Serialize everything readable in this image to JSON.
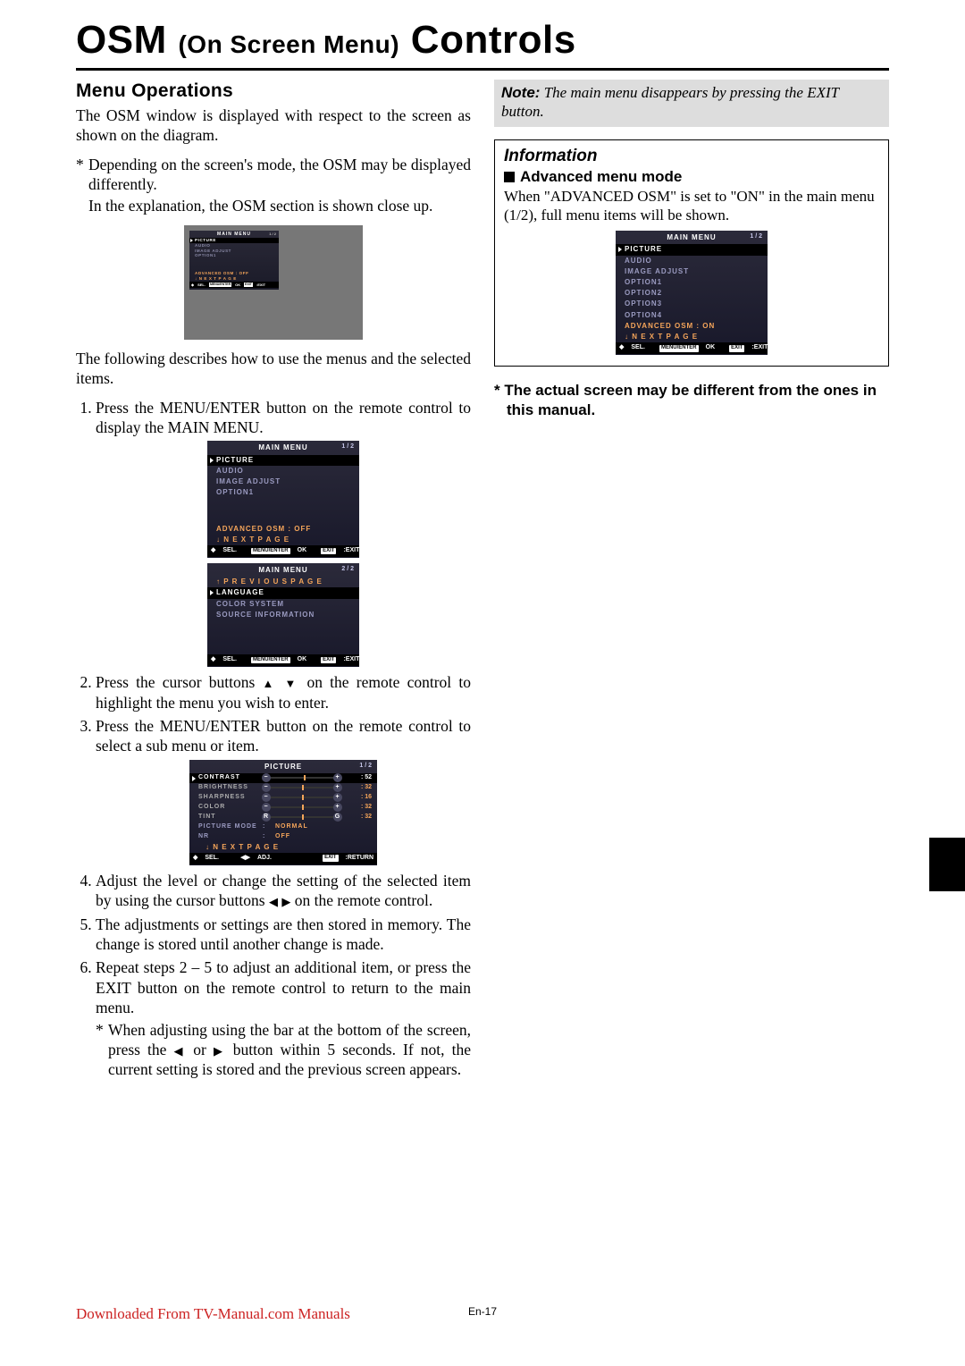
{
  "page": {
    "title_1": "OSM",
    "title_2": "(On Screen Menu)",
    "title_3": "Controls",
    "footer_link": "Downloaded From TV-Manual.com Manuals",
    "footer_page": "En-17"
  },
  "left": {
    "heading": "Menu Operations",
    "p1": "The OSM window is displayed with respect to the screen as shown on the diagram.",
    "star1": "Depending on the screen's mode, the OSM may be displayed differently.",
    "star1b": "In the explanation, the OSM section is shown close up.",
    "p2": "The following describes how to use the menus and the selected items.",
    "s1": "Press the MENU/ENTER button on the remote control to display the MAIN MENU.",
    "s2a": "Press the cursor buttons ",
    "s2b": " on the remote control to highlight the menu you wish to enter.",
    "s3": "Press the MENU/ENTER button on the remote control to select a sub menu or item.",
    "s4a": "Adjust the level or change the setting of the selected item by using the cursor buttons ",
    "s4b": " on the remote control.",
    "s5": "The adjustments or settings are then stored in memory. The change is stored until another change is made.",
    "s6": "Repeat steps 2 – 5 to adjust an additional item, or press the EXIT button on the remote control to return to the main menu.",
    "s6_star_a": "When adjusting using the bar at the bottom of the screen, press the ",
    "s6_star_b": " or ",
    "s6_star_c": " button within 5 seconds. If not, the current setting is stored and the previous screen appears."
  },
  "osd_common": {
    "main_title": "MAIN MENU",
    "picture_title": "PICTURE",
    "page12": "1 / 2",
    "page22": "2 / 2",
    "sel": "SEL.",
    "adj": "ADJ.",
    "menu_enter": "MENU/ENTER",
    "ok": "OK",
    "exit_btn": "EXIT",
    "exit_txt": ":EXIT",
    "return_txt": ":RETURN",
    "items_basic": [
      "PICTURE",
      "AUDIO",
      "IMAGE ADJUST",
      "OPTION1"
    ],
    "adv_off": "ADVANCED OSM   :   OFF",
    "adv_on": "ADVANCED OSM   :   ON",
    "next": "↓  N E X T   P A G E",
    "prev": "↑  P R E V I O U S   P A G E",
    "items_p2": [
      "LANGUAGE",
      "COLOR SYSTEM",
      "SOURCE INFORMATION"
    ],
    "items_full": [
      "PICTURE",
      "AUDIO",
      "IMAGE ADJUST",
      "OPTION1",
      "OPTION2",
      "OPTION3",
      "OPTION4"
    ]
  },
  "picture_adj": {
    "rows": [
      {
        "label": "CONTRAST",
        "val": 52,
        "pos": 52,
        "l": "−",
        "r": "+"
      },
      {
        "label": "BRIGHTNESS",
        "val": 32,
        "pos": 50,
        "l": "−",
        "r": "+"
      },
      {
        "label": "SHARPNESS",
        "val": 16,
        "pos": 50,
        "l": "−",
        "r": "+"
      },
      {
        "label": "COLOR",
        "val": 32,
        "pos": 50,
        "l": "−",
        "r": "+"
      },
      {
        "label": "TINT",
        "val": 32,
        "pos": 50,
        "l": "R",
        "r": "G"
      }
    ],
    "modes": [
      {
        "label": "PICTURE MODE",
        "val": "NORMAL"
      },
      {
        "label": "NR",
        "val": "OFF"
      }
    ]
  },
  "right": {
    "note_label": "Note:",
    "note_text": " The main menu disappears by pressing the EXIT button.",
    "info_head": "Information",
    "info_sub": "Advanced menu mode",
    "info_body": "When \"ADVANCED OSM\" is set to \"ON\" in the main menu (1/2), full menu items will be shown.",
    "disclaimer": "*  The actual screen may be different from the ones in this manual."
  }
}
